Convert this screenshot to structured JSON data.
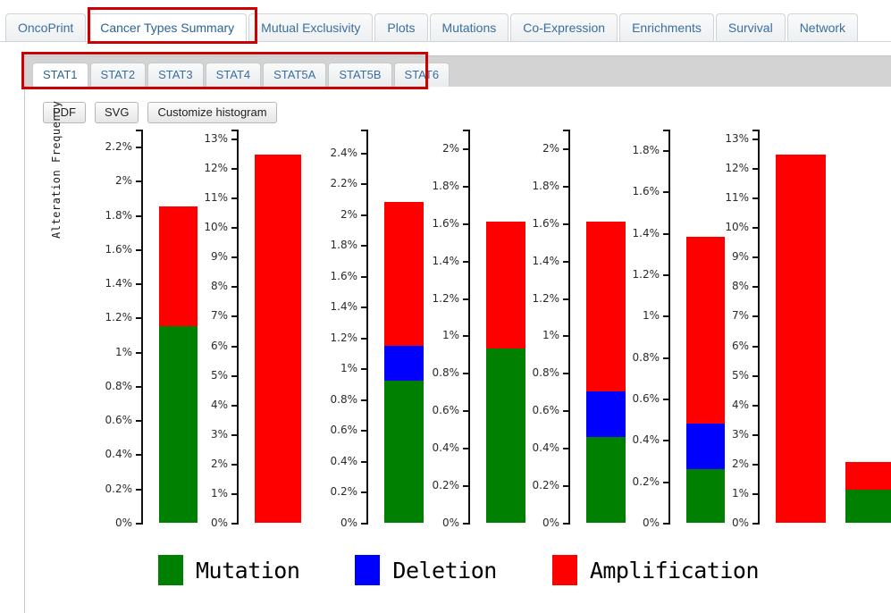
{
  "main_tabs": [
    {
      "label": "OncoPrint",
      "active": false
    },
    {
      "label": "Cancer Types Summary",
      "active": true
    },
    {
      "label": "Mutual Exclusivity",
      "active": false
    },
    {
      "label": "Plots",
      "active": false
    },
    {
      "label": "Mutations",
      "active": false
    },
    {
      "label": "Co-Expression",
      "active": false
    },
    {
      "label": "Enrichments",
      "active": false
    },
    {
      "label": "Survival",
      "active": false
    },
    {
      "label": "Network",
      "active": false
    }
  ],
  "sub_tabs": [
    {
      "label": "STAT1",
      "active": true
    },
    {
      "label": "STAT2",
      "active": false
    },
    {
      "label": "STAT3",
      "active": false
    },
    {
      "label": "STAT4",
      "active": false
    },
    {
      "label": "STAT5A",
      "active": false
    },
    {
      "label": "STAT5B",
      "active": false
    },
    {
      "label": "STAT6",
      "active": false
    }
  ],
  "toolbar": {
    "pdf_label": "PDF",
    "svg_label": "SVG",
    "customize_label": "Customize histogram"
  },
  "colors": {
    "mutation": "#008000",
    "deletion": "#0000ff",
    "amplification": "#ff0000",
    "axis": "#111111",
    "tab_text": "#3a6e9e",
    "annotation_box": "#cc0000"
  },
  "legend": [
    {
      "label": "Mutation",
      "color": "#008000",
      "key": "mutation"
    },
    {
      "label": "Deletion",
      "color": "#0000ff",
      "key": "deletion"
    },
    {
      "label": "Amplification",
      "color": "#ff0000",
      "key": "amplification"
    }
  ],
  "chart_data": {
    "type": "bar",
    "title": "",
    "xlabel": "",
    "ylabel": "Alteration Frequency",
    "stacked": true,
    "grid": false,
    "legend_position": "bottom",
    "series_names": [
      "Mutation",
      "Deletion",
      "Amplification"
    ],
    "panels": [
      {
        "index": 1,
        "ylim": [
          0,
          2.3
        ],
        "tick_step": 0.2,
        "tick_labels": [
          "0%",
          "0.2%",
          "0.4%",
          "0.6%",
          "0.8%",
          "1%",
          "1.2%",
          "1.4%",
          "1.6%",
          "1.8%",
          "2%",
          "2.2%"
        ],
        "tick_values": [
          0,
          0.2,
          0.4,
          0.6,
          0.8,
          1.0,
          1.2,
          1.4,
          1.6,
          1.8,
          2.0,
          2.2
        ],
        "bars": [
          {
            "mutation": 1.15,
            "deletion": 0,
            "amplification": 0.7,
            "total": 1.85
          }
        ]
      },
      {
        "index": 2,
        "ylim": [
          0,
          13.3
        ],
        "tick_step": 1,
        "tick_labels": [
          "0%",
          "1%",
          "2%",
          "3%",
          "4%",
          "5%",
          "6%",
          "7%",
          "8%",
          "9%",
          "10%",
          "11%",
          "12%",
          "13%"
        ],
        "tick_values": [
          0,
          1,
          2,
          3,
          4,
          5,
          6,
          7,
          8,
          9,
          10,
          11,
          12,
          13
        ],
        "bars": [
          {
            "mutation": 0,
            "deletion": 0,
            "amplification": 12.45,
            "total": 12.45
          }
        ]
      },
      {
        "index": 3,
        "ylim": [
          0,
          2.55
        ],
        "tick_step": 0.2,
        "tick_labels": [
          "0%",
          "0.2%",
          "0.4%",
          "0.6%",
          "0.8%",
          "1%",
          "1.2%",
          "1.4%",
          "1.6%",
          "1.8%",
          "2%",
          "2.2%",
          "2.4%"
        ],
        "tick_values": [
          0,
          0.2,
          0.4,
          0.6,
          0.8,
          1.0,
          1.2,
          1.4,
          1.6,
          1.8,
          2.0,
          2.2,
          2.4
        ],
        "bars": [
          {
            "mutation": 0.92,
            "deletion": 0.23,
            "amplification": 0.93,
            "total": 2.08
          }
        ]
      },
      {
        "index": 4,
        "ylim": [
          0,
          2.1
        ],
        "tick_step": 0.2,
        "tick_labels": [
          "0%",
          "0.2%",
          "0.4%",
          "0.6%",
          "0.8%",
          "1%",
          "1.2%",
          "1.4%",
          "1.6%",
          "1.8%",
          "2%"
        ],
        "tick_values": [
          0,
          0.2,
          0.4,
          0.6,
          0.8,
          1.0,
          1.2,
          1.4,
          1.6,
          1.8,
          2.0
        ],
        "bars": [
          {
            "mutation": 0.93,
            "deletion": 0,
            "amplification": 0.68,
            "total": 1.61
          }
        ]
      },
      {
        "index": 5,
        "ylim": [
          0,
          2.1
        ],
        "tick_step": 0.2,
        "tick_labels": [
          "0%",
          "0.2%",
          "0.4%",
          "0.6%",
          "0.8%",
          "1%",
          "1.2%",
          "1.4%",
          "1.6%",
          "1.8%",
          "2%"
        ],
        "tick_values": [
          0,
          0.2,
          0.4,
          0.6,
          0.8,
          1.0,
          1.2,
          1.4,
          1.6,
          1.8,
          2.0
        ],
        "bars": [
          {
            "mutation": 0.46,
            "deletion": 0.24,
            "amplification": 0.91,
            "total": 1.61
          }
        ]
      },
      {
        "index": 6,
        "ylim": [
          0,
          1.9
        ],
        "tick_step": 0.2,
        "tick_labels": [
          "0%",
          "0.2%",
          "0.4%",
          "0.6%",
          "0.8%",
          "1%",
          "1.2%",
          "1.4%",
          "1.6%",
          "1.8%"
        ],
        "tick_values": [
          0,
          0.2,
          0.4,
          0.6,
          0.8,
          1.0,
          1.2,
          1.4,
          1.6,
          1.8
        ],
        "bars": [
          {
            "mutation": 0.26,
            "deletion": 0.22,
            "amplification": 0.9,
            "total": 1.38
          }
        ]
      },
      {
        "index": 7,
        "ylim": [
          0,
          13.3
        ],
        "tick_step": 1,
        "tick_labels": [
          "0%",
          "1%",
          "2%",
          "3%",
          "4%",
          "5%",
          "6%",
          "7%",
          "8%",
          "9%",
          "10%",
          "11%",
          "12%",
          "13%"
        ],
        "tick_values": [
          0,
          1,
          2,
          3,
          4,
          5,
          6,
          7,
          8,
          9,
          10,
          11,
          12,
          13
        ],
        "bars": [
          {
            "mutation": 0,
            "deletion": 0,
            "amplification": 12.45,
            "total": 12.45
          },
          {
            "mutation": 1.12,
            "deletion": 0,
            "amplification": 0.95,
            "total": 2.07
          }
        ]
      }
    ]
  }
}
